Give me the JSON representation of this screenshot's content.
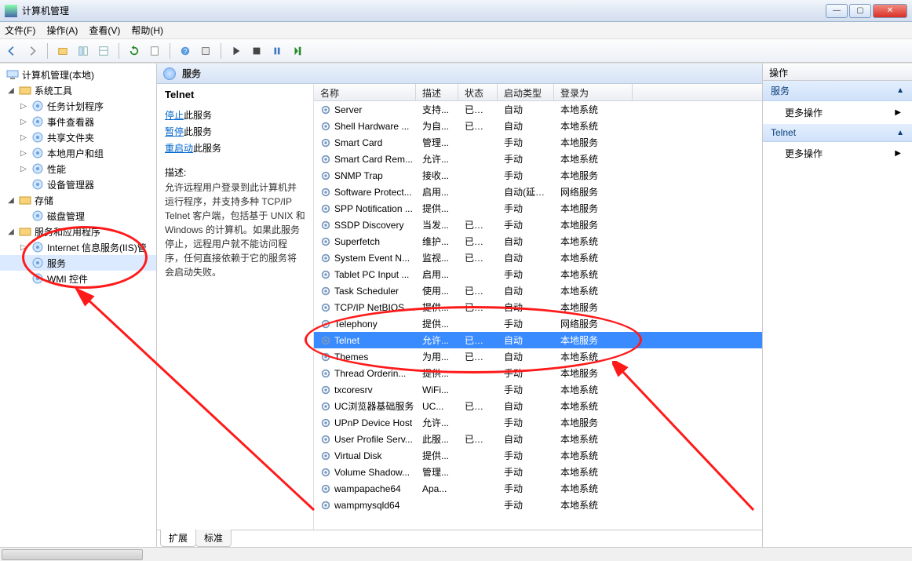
{
  "window": {
    "title": "计算机管理"
  },
  "menu": [
    "文件(F)",
    "操作(A)",
    "查看(V)",
    "帮助(H)"
  ],
  "tree": {
    "root": "计算机管理(本地)",
    "groups": [
      {
        "label": "系统工具",
        "items": [
          {
            "label": "任务计划程序",
            "exp": true
          },
          {
            "label": "事件查看器",
            "exp": true
          },
          {
            "label": "共享文件夹",
            "exp": true
          },
          {
            "label": "本地用户和组",
            "exp": true
          },
          {
            "label": "性能",
            "exp": true
          },
          {
            "label": "设备管理器",
            "exp": false
          }
        ]
      },
      {
        "label": "存储",
        "items": [
          {
            "label": "磁盘管理",
            "exp": false
          }
        ]
      },
      {
        "label": "服务和应用程序",
        "items": [
          {
            "label": "Internet 信息服务(IIS)管",
            "exp": true
          },
          {
            "label": "服务",
            "exp": false,
            "selected": true
          },
          {
            "label": "WMI 控件",
            "exp": false
          }
        ]
      }
    ]
  },
  "center": {
    "header": "服务",
    "selected": "Telnet",
    "links": {
      "stop": "停止",
      "stop_suffix": "此服务",
      "pause": "暂停",
      "pause_suffix": "此服务",
      "restart": "重启动",
      "restart_suffix": "此服务"
    },
    "desc_label": "描述:",
    "desc": "允许远程用户登录到此计算机并运行程序，并支持多种 TCP/IP Telnet 客户端，包括基于 UNIX 和 Windows 的计算机。如果此服务停止，远程用户就不能访问程序，任何直接依赖于它的服务将会启动失败。"
  },
  "columns": {
    "name": "名称",
    "desc": "描述",
    "status": "状态",
    "startup": "启动类型",
    "login": "登录为"
  },
  "tabs": [
    "扩展",
    "标准"
  ],
  "actions": {
    "header": "操作",
    "g1": "服务",
    "g1_item": "更多操作",
    "g2": "Telnet",
    "g2_item": "更多操作"
  },
  "services": [
    {
      "name": "Server",
      "desc": "支持...",
      "status": "已启动",
      "startup": "自动",
      "login": "本地系统"
    },
    {
      "name": "Shell Hardware ...",
      "desc": "为自...",
      "status": "已启动",
      "startup": "自动",
      "login": "本地系统"
    },
    {
      "name": "Smart Card",
      "desc": "管理...",
      "status": "",
      "startup": "手动",
      "login": "本地服务"
    },
    {
      "name": "Smart Card Rem...",
      "desc": "允许...",
      "status": "",
      "startup": "手动",
      "login": "本地系统"
    },
    {
      "name": "SNMP Trap",
      "desc": "接收...",
      "status": "",
      "startup": "手动",
      "login": "本地服务"
    },
    {
      "name": "Software Protect...",
      "desc": "启用...",
      "status": "",
      "startup": "自动(延迟...",
      "login": "网络服务"
    },
    {
      "name": "SPP Notification ...",
      "desc": "提供...",
      "status": "",
      "startup": "手动",
      "login": "本地服务"
    },
    {
      "name": "SSDP Discovery",
      "desc": "当发...",
      "status": "已启动",
      "startup": "手动",
      "login": "本地服务"
    },
    {
      "name": "Superfetch",
      "desc": "维护...",
      "status": "已启动",
      "startup": "自动",
      "login": "本地系统"
    },
    {
      "name": "System Event N...",
      "desc": "监视...",
      "status": "已启动",
      "startup": "自动",
      "login": "本地系统"
    },
    {
      "name": "Tablet PC Input ...",
      "desc": "启用...",
      "status": "",
      "startup": "手动",
      "login": "本地系统"
    },
    {
      "name": "Task Scheduler",
      "desc": "使用...",
      "status": "已启动",
      "startup": "自动",
      "login": "本地系统"
    },
    {
      "name": "TCP/IP NetBIOS ...",
      "desc": "提供...",
      "status": "已启动",
      "startup": "自动",
      "login": "本地服务"
    },
    {
      "name": "Telephony",
      "desc": "提供...",
      "status": "",
      "startup": "手动",
      "login": "网络服务"
    },
    {
      "name": "Telnet",
      "desc": "允许...",
      "status": "已启动",
      "startup": "自动",
      "login": "本地服务",
      "selected": true
    },
    {
      "name": "Themes",
      "desc": "为用...",
      "status": "已启动",
      "startup": "自动",
      "login": "本地系统"
    },
    {
      "name": "Thread Orderin...",
      "desc": "提供...",
      "status": "",
      "startup": "手动",
      "login": "本地服务"
    },
    {
      "name": "txcoresrv",
      "desc": "WiFi...",
      "status": "",
      "startup": "手动",
      "login": "本地系统"
    },
    {
      "name": "UC浏览器基础服务",
      "desc": "UC...",
      "status": "已启动",
      "startup": "自动",
      "login": "本地系统"
    },
    {
      "name": "UPnP Device Host",
      "desc": "允许...",
      "status": "",
      "startup": "手动",
      "login": "本地服务"
    },
    {
      "name": "User Profile Serv...",
      "desc": "此服...",
      "status": "已启动",
      "startup": "自动",
      "login": "本地系统"
    },
    {
      "name": "Virtual Disk",
      "desc": "提供...",
      "status": "",
      "startup": "手动",
      "login": "本地系统"
    },
    {
      "name": "Volume Shadow...",
      "desc": "管理...",
      "status": "",
      "startup": "手动",
      "login": "本地系统"
    },
    {
      "name": "wampapache64",
      "desc": "Apa...",
      "status": "",
      "startup": "手动",
      "login": "本地系统"
    },
    {
      "name": "wampmysqld64",
      "desc": "",
      "status": "",
      "startup": "手动",
      "login": "本地系统"
    }
  ]
}
